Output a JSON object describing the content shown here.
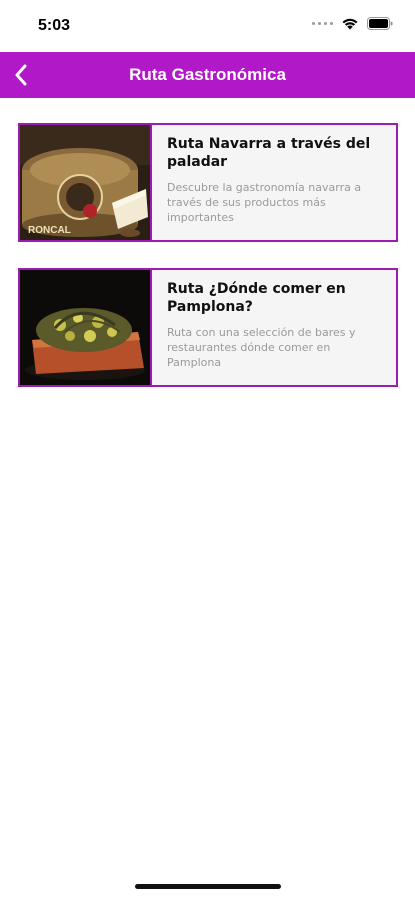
{
  "status_bar": {
    "time": "5:03"
  },
  "header": {
    "title": "Ruta Gastronómica",
    "back_icon": "chevron-left-icon",
    "color": "#b118c8"
  },
  "routes": [
    {
      "title": "Ruta Navarra a través del paladar",
      "description": "Descubre la gastronomía navarra a través de sus productos más importantes",
      "image": "cheese-photo",
      "image_label": "RONCAL"
    },
    {
      "title": "Ruta ¿Dónde comer en Pamplona?",
      "description": "Ruta con una selección de bares y restaurantes dónde comer en Pamplona",
      "image": "pintxo-photo"
    }
  ],
  "colors": {
    "card_border": "#9c1bb5",
    "card_bg": "#f5f5f5"
  }
}
